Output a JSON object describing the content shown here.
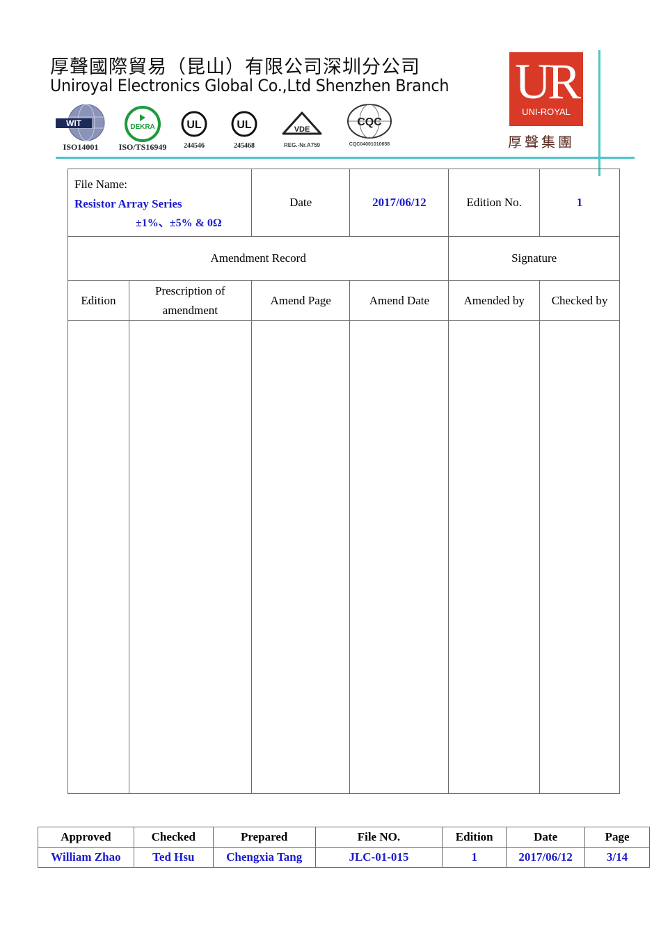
{
  "header": {
    "company_cn": "厚聲國際貿易（昆山）有限公司深圳分公司",
    "company_en": "Uniroyal Electronics Global Co.,Ltd Shenzhen Branch",
    "certifications": [
      {
        "icon": "globe-wit-icon",
        "label": "ISO14001"
      },
      {
        "icon": "dekra-icon",
        "label": "ISO/TS16949"
      },
      {
        "icon": "ul-icon",
        "label": "244546"
      },
      {
        "icon": "ul-icon",
        "label": "245468"
      },
      {
        "icon": "vde-icon",
        "label": "REG.-Nr.A759"
      },
      {
        "icon": "cqc-icon",
        "label": "CQC04001010658"
      }
    ],
    "logo": {
      "mark": "UR",
      "brand": "UNI-ROYAL",
      "group_cn": "厚聲集團",
      "color": "#d93a27"
    },
    "accent_color": "#4cc5c8"
  },
  "info": {
    "file_name_label": "File Name:",
    "file_name_line1": "Resistor Array Series",
    "file_name_line2": "±1%、±5% & 0Ω",
    "date_label": "Date",
    "date_value": "2017/06/12",
    "edition_label": "Edition No.",
    "edition_value": "1"
  },
  "amendment": {
    "record_title": "Amendment Record",
    "signature_title": "Signature",
    "columns": [
      "Edition",
      "Prescription of amendment",
      "Amend Page",
      "Amend Date",
      "Amended by",
      "Checked by"
    ],
    "rows": []
  },
  "footer": {
    "headers": [
      "Approved",
      "Checked",
      "Prepared",
      "File NO.",
      "Edition",
      "Date",
      "Page"
    ],
    "values": [
      "William Zhao",
      "Ted Hsu",
      "Chengxia Tang",
      "JLC-01-015",
      "1",
      "2017/06/12",
      "3/14"
    ]
  },
  "colors": {
    "value_text": "#1a1acc",
    "border": "#6b6b6b"
  }
}
